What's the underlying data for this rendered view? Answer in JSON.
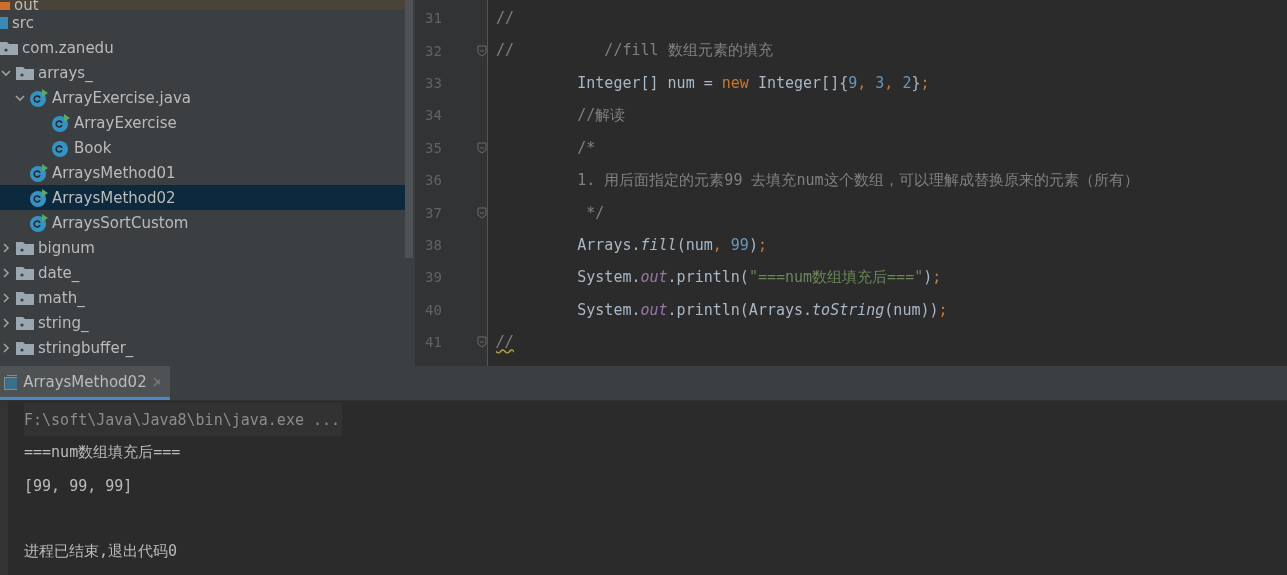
{
  "project_tree": {
    "items": [
      {
        "label": "out",
        "kind": "folder-orange",
        "selected": false
      },
      {
        "label": "src",
        "kind": "source-root",
        "selected": false,
        "children": [
          {
            "label": "com.zanedu",
            "kind": "package",
            "selected": false,
            "children": [
              {
                "label": "arrays_",
                "kind": "package",
                "expanded": true,
                "selected": false,
                "children": [
                  {
                    "label": "ArrayExercise.java",
                    "kind": "runnable-class",
                    "expanded": true,
                    "selected": false,
                    "children": [
                      {
                        "label": "ArrayExercise",
                        "kind": "runnable-class",
                        "selected": false
                      },
                      {
                        "label": "Book",
                        "kind": "class",
                        "selected": false
                      }
                    ]
                  },
                  {
                    "label": "ArraysMethod01",
                    "kind": "runnable-class",
                    "selected": false
                  },
                  {
                    "label": "ArraysMethod02",
                    "kind": "runnable-class",
                    "selected": true
                  },
                  {
                    "label": "ArraysSortCustom",
                    "kind": "runnable-class",
                    "selected": false
                  }
                ]
              },
              {
                "label": "bignum",
                "kind": "package",
                "expanded": false,
                "selected": false
              },
              {
                "label": "date_",
                "kind": "package",
                "expanded": false,
                "selected": false
              },
              {
                "label": "math_",
                "kind": "package",
                "expanded": false,
                "selected": false
              },
              {
                "label": "string_",
                "kind": "package",
                "expanded": false,
                "selected": false
              },
              {
                "label": "stringbuffer_",
                "kind": "package",
                "expanded": false,
                "selected": false
              }
            ]
          }
        ]
      }
    ]
  },
  "editor": {
    "lines": [
      {
        "number": "31",
        "fold": false,
        "tokens": [
          {
            "text": "//",
            "kind": "comment"
          }
        ]
      },
      {
        "number": "32",
        "fold": true,
        "tokens": [
          {
            "text": "//          //fill 数组元素的填充",
            "kind": "comment"
          }
        ]
      },
      {
        "number": "33",
        "fold": false,
        "tokens": [
          {
            "text": "         Integer[] num = ",
            "kind": "plain"
          },
          {
            "text": "new",
            "kind": "keyword"
          },
          {
            "text": " Integer[]{",
            "kind": "plain"
          },
          {
            "text": "9",
            "kind": "number"
          },
          {
            "text": ", ",
            "kind": "keyword"
          },
          {
            "text": "3",
            "kind": "number"
          },
          {
            "text": ", ",
            "kind": "keyword"
          },
          {
            "text": "2",
            "kind": "number"
          },
          {
            "text": "}",
            "kind": "plain"
          },
          {
            "text": ";",
            "kind": "keyword"
          }
        ]
      },
      {
        "number": "34",
        "fold": false,
        "tokens": [
          {
            "text": "         //解读",
            "kind": "comment"
          }
        ]
      },
      {
        "number": "35",
        "fold": true,
        "tokens": [
          {
            "text": "         /*",
            "kind": "comment"
          }
        ]
      },
      {
        "number": "36",
        "fold": false,
        "tokens": [
          {
            "text": "         1. 用后面指定的元素99 去填充num这个数组，可以理解成替换原来的元素（所有）",
            "kind": "comment"
          }
        ]
      },
      {
        "number": "37",
        "fold": true,
        "tokens": [
          {
            "text": "          */",
            "kind": "comment"
          }
        ]
      },
      {
        "number": "38",
        "fold": false,
        "tokens": [
          {
            "text": "         Arrays.",
            "kind": "plain"
          },
          {
            "text": "fill",
            "kind": "method-italic"
          },
          {
            "text": "(num",
            "kind": "plain"
          },
          {
            "text": ", ",
            "kind": "keyword"
          },
          {
            "text": "99",
            "kind": "number"
          },
          {
            "text": ")",
            "kind": "plain"
          },
          {
            "text": ";",
            "kind": "keyword"
          }
        ]
      },
      {
        "number": "39",
        "fold": false,
        "tokens": [
          {
            "text": "         System.",
            "kind": "plain"
          },
          {
            "text": "out",
            "kind": "static"
          },
          {
            "text": ".println(",
            "kind": "plain"
          },
          {
            "text": "\"===num数组填充后===\"",
            "kind": "string"
          },
          {
            "text": ")",
            "kind": "plain"
          },
          {
            "text": ";",
            "kind": "keyword"
          }
        ]
      },
      {
        "number": "40",
        "fold": false,
        "tokens": [
          {
            "text": "         System.",
            "kind": "plain"
          },
          {
            "text": "out",
            "kind": "static"
          },
          {
            "text": ".println(Arrays.",
            "kind": "plain"
          },
          {
            "text": "toString",
            "kind": "method-italic"
          },
          {
            "text": "(num))",
            "kind": "plain"
          },
          {
            "text": ";",
            "kind": "keyword"
          }
        ]
      },
      {
        "number": "41",
        "fold": true,
        "tokens": [
          {
            "text": "//",
            "kind": "squiggle"
          }
        ]
      }
    ]
  },
  "run_panel": {
    "tabs": [
      {
        "label": "ArraysMethod02",
        "selected": true
      }
    ],
    "console": [
      {
        "text": "F:\\soft\\Java\\Java8\\bin\\java.exe ...",
        "kind": "command"
      },
      {
        "text": "===num数组填充后===",
        "kind": "output"
      },
      {
        "text": "[99, 99, 99]",
        "kind": "output"
      },
      {
        "kind": "blank"
      },
      {
        "text": "进程已结束,退出代码0",
        "kind": "output"
      }
    ]
  }
}
